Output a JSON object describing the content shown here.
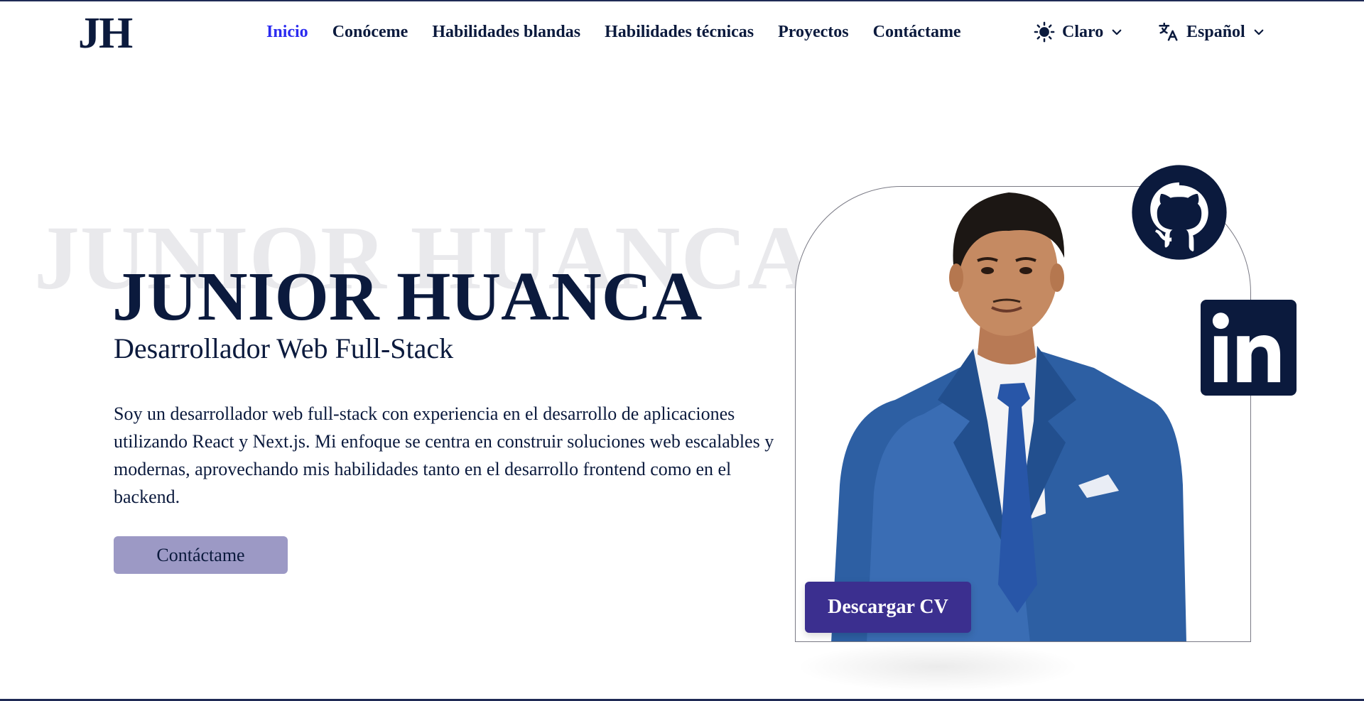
{
  "header": {
    "logo": "JH",
    "nav": [
      {
        "label": "Inicio",
        "active": true
      },
      {
        "label": "Conóceme"
      },
      {
        "label": "Habilidades blandas"
      },
      {
        "label": "Habilidades técnicas"
      },
      {
        "label": "Proyectos"
      },
      {
        "label": "Contáctame"
      }
    ],
    "theme": {
      "label": "Claro",
      "icon": "sun-icon"
    },
    "language": {
      "label": "Español",
      "icon": "translate-icon"
    }
  },
  "hero": {
    "background_name": "JUNIOR HUANCA",
    "title": "JUNIOR HUANCA",
    "subtitle": "Desarrollador Web Full-Stack",
    "description": "Soy un desarrollador web full-stack con experiencia en el desarrollo de aplicaciones utilizando React y Next.js. Mi enfoque se centra en construir soluciones web escalables y modernas, aprovechando mis habilidades tanto en el desarrollo frontend como en el backend.",
    "contact_button": "Contáctame",
    "cv_button": "Descargar CV"
  },
  "social": [
    {
      "name": "GitHub",
      "icon": "github-icon"
    },
    {
      "name": "LinkedIn",
      "icon": "linkedin-icon"
    }
  ],
  "colors": {
    "primary_text": "#0b1a3d",
    "active_nav": "#2b2bf0",
    "contact_button_bg": "#9c99c5",
    "cv_button_bg": "#3b2f8f"
  }
}
